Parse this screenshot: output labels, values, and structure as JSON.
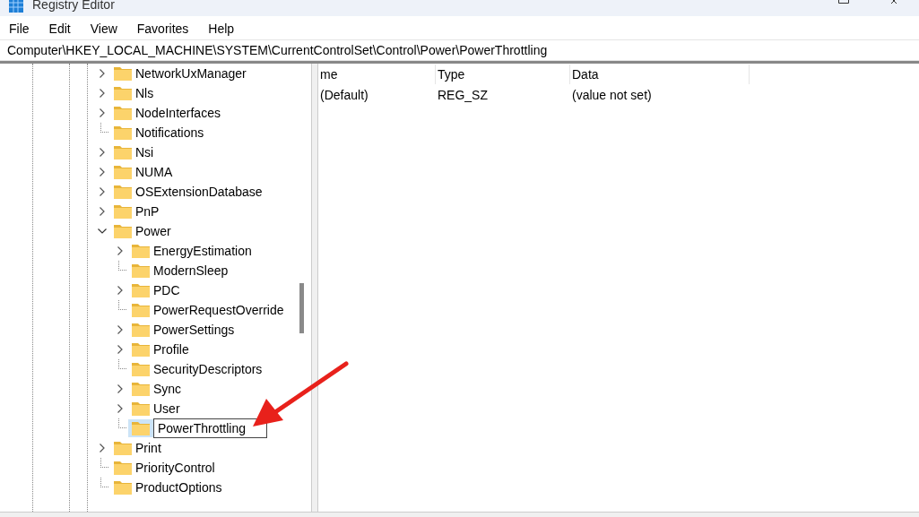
{
  "window": {
    "title": "Registry Editor"
  },
  "menu": [
    "File",
    "Edit",
    "View",
    "Favorites",
    "Help"
  ],
  "address": "Computer\\HKEY_LOCAL_MACHINE\\SYSTEM\\CurrentControlSet\\Control\\Power\\PowerThrottling",
  "tree": [
    {
      "label": "NetworkUxManager",
      "kind": "collapsed"
    },
    {
      "label": "Nls",
      "kind": "collapsed"
    },
    {
      "label": "NodeInterfaces",
      "kind": "collapsed"
    },
    {
      "label": "Notifications",
      "kind": "leaf"
    },
    {
      "label": "Nsi",
      "kind": "collapsed"
    },
    {
      "label": "NUMA",
      "kind": "collapsed"
    },
    {
      "label": "OSExtensionDatabase",
      "kind": "collapsed"
    },
    {
      "label": "PnP",
      "kind": "collapsed"
    },
    {
      "label": "Power",
      "kind": "expanded",
      "children": [
        {
          "label": "EnergyEstimation",
          "kind": "collapsed"
        },
        {
          "label": "ModernSleep",
          "kind": "leaf"
        },
        {
          "label": "PDC",
          "kind": "collapsed"
        },
        {
          "label": "PowerRequestOverride",
          "kind": "leaf"
        },
        {
          "label": "PowerSettings",
          "kind": "collapsed"
        },
        {
          "label": "Profile",
          "kind": "collapsed"
        },
        {
          "label": "SecurityDescriptors",
          "kind": "leaf"
        },
        {
          "label": "Sync",
          "kind": "collapsed"
        },
        {
          "label": "User",
          "kind": "collapsed"
        },
        {
          "label": "PowerThrottling",
          "kind": "renaming"
        }
      ]
    },
    {
      "label": "Print",
      "kind": "collapsed"
    },
    {
      "label": "PriorityControl",
      "kind": "leaf"
    },
    {
      "label": "ProductOptions",
      "kind": "leaf"
    }
  ],
  "list": {
    "columns": [
      "me",
      "Type",
      "Data"
    ],
    "rows": [
      [
        "(Default)",
        "REG_SZ",
        "(value not set)"
      ]
    ]
  }
}
